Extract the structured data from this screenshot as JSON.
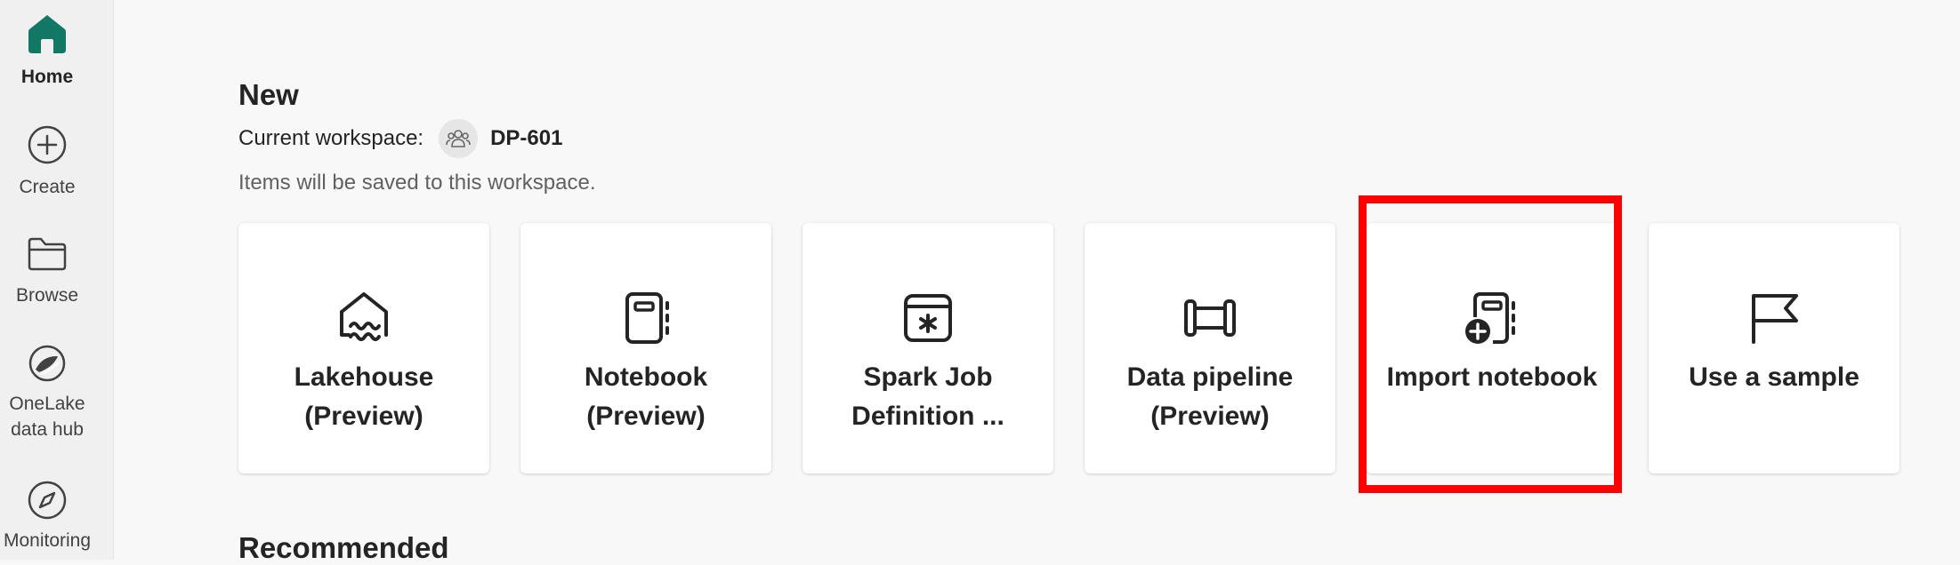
{
  "rail": {
    "items": [
      {
        "label": "Home",
        "icon": "home-icon"
      },
      {
        "label": "Create",
        "icon": "plus-circle-icon"
      },
      {
        "label": "Browse",
        "icon": "folder-icon"
      },
      {
        "label": "OneLake data hub",
        "icon": "onelake-icon"
      },
      {
        "label": "Monitoring",
        "icon": "compass-icon"
      }
    ],
    "active_color": "#117865"
  },
  "new_section": {
    "title": "New",
    "workspace_label": "Current workspace:",
    "workspace_name": "DP-601",
    "save_note": "Items will be saved to this workspace."
  },
  "cards": [
    {
      "label": "Lakehouse (Preview)",
      "icon": "lakehouse-icon"
    },
    {
      "label": "Notebook (Preview)",
      "icon": "notebook-icon"
    },
    {
      "label": "Spark Job Definition ...",
      "icon": "spark-job-icon"
    },
    {
      "label": "Data pipeline (Preview)",
      "icon": "pipeline-icon"
    },
    {
      "label": "Import notebook",
      "icon": "import-notebook-icon"
    },
    {
      "label": "Use a sample",
      "icon": "flag-icon"
    }
  ],
  "highlight_color": "#ff0000",
  "recommended_title": "Recommended"
}
